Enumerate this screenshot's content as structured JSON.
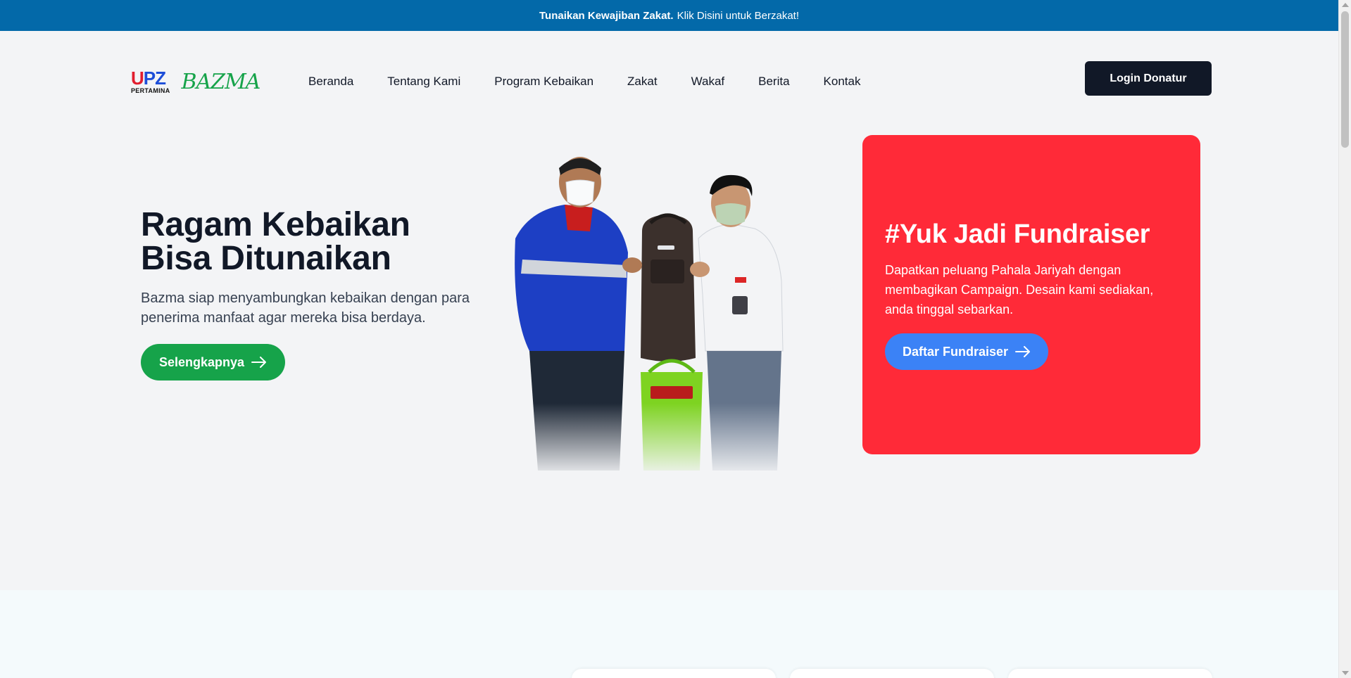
{
  "announcement": {
    "bold_text": "Tunaikan Kewajiban Zakat.",
    "link_text": "Klik Disini untuk Berzakat!"
  },
  "logo": {
    "upz_letters": [
      "U",
      "P",
      "Z"
    ],
    "upz_subtext": "PERTAMINA",
    "bazma_text": "BAZMA",
    "icon": "star-ornament-icon"
  },
  "nav": {
    "items": [
      {
        "label": "Beranda"
      },
      {
        "label": "Tentang Kami"
      },
      {
        "label": "Program Kebaikan"
      },
      {
        "label": "Zakat"
      },
      {
        "label": "Wakaf"
      },
      {
        "label": "Berita"
      },
      {
        "label": "Kontak"
      }
    ],
    "login_label": "Login Donatur"
  },
  "hero": {
    "title_line1": "Ragam Kebaikan",
    "title_line2": "Bisa Ditunaikan",
    "description": "Bazma siap menyambungkan kebaikan dengan para penerima manfaat agar mereka bisa berdaya.",
    "button_label": "Selengkapnya",
    "button_icon": "arrow-right-icon"
  },
  "fundraiser": {
    "title": "#Yuk Jadi Fundraiser",
    "description": "Dapatkan peluang Pahala Jariyah dengan membagikan Campaign. Desain kami sediakan, anda tinggal sebarkan.",
    "button_label": "Daftar Fundraiser",
    "button_icon": "arrow-right-icon"
  },
  "colors": {
    "announcement_bg": "#0369a9",
    "login_bg": "#111827",
    "hero_button": "#16a34a",
    "fund_card_bg": "#ff2a38",
    "fund_button": "#3b82f6"
  }
}
